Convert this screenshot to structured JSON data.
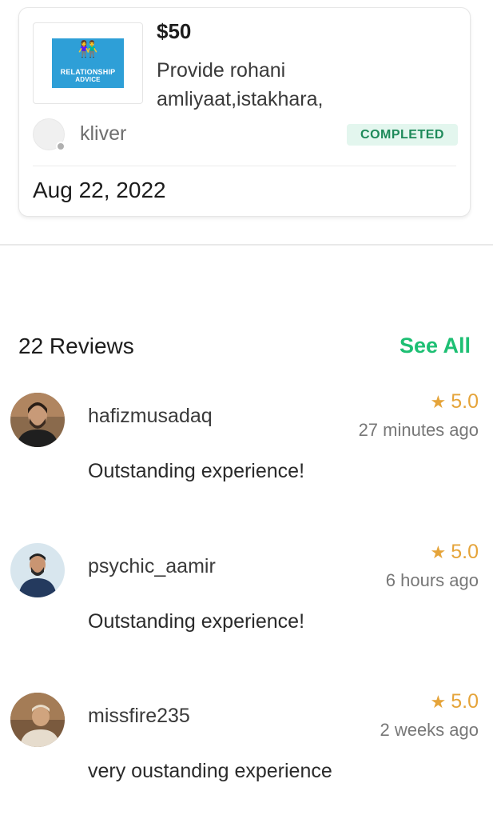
{
  "order": {
    "thumbnail_text_line1": "RELATIONSHIP",
    "thumbnail_text_line2": "ADVICE",
    "price": "$50",
    "description": "Provide rohani amliyaat,istakhara,",
    "seller": "kliver",
    "status": "COMPLETED",
    "date": "Aug 22, 2022",
    "colors": {
      "status_bg": "#e3f6ee",
      "status_text": "#1e8a5a",
      "thumb_bg": "#2e9fd7"
    }
  },
  "reviews_section": {
    "count_label": "22 Reviews",
    "see_all": "See All",
    "accent": "#1dbf73"
  },
  "reviews": [
    {
      "user": "hafizmusadaq",
      "rating": "5.0",
      "time": "27 minutes ago",
      "text": "Outstanding experience!"
    },
    {
      "user": "psychic_aamir",
      "rating": "5.0",
      "time": "6 hours ago",
      "text": "Outstanding experience!"
    },
    {
      "user": "missfire235",
      "rating": "5.0",
      "time": "2 weeks ago",
      "text": "very oustanding experience"
    }
  ],
  "icons": {
    "star": "star-icon",
    "avatar": "user-avatar"
  }
}
